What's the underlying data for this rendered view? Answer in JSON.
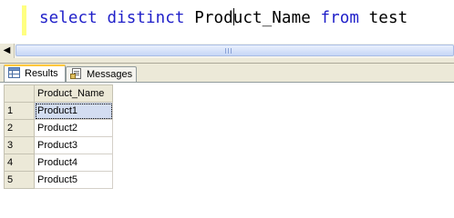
{
  "editor": {
    "keyword_select": "select",
    "keyword_distinct": "distinct",
    "identifier_before_caret": "Prod",
    "identifier_after_caret": "uct_Name",
    "keyword_from": "from",
    "table_name": "test"
  },
  "tabs": [
    {
      "label": "Results",
      "icon": "grid-icon",
      "active": true
    },
    {
      "label": "Messages",
      "icon": "messages-icon",
      "active": false
    }
  ],
  "grid": {
    "columns": [
      "Product_Name"
    ],
    "rows": [
      {
        "num": "1",
        "value": "Product1",
        "selected": true
      },
      {
        "num": "2",
        "value": "Product2",
        "selected": false
      },
      {
        "num": "3",
        "value": "Product3",
        "selected": false
      },
      {
        "num": "4",
        "value": "Product4",
        "selected": false
      },
      {
        "num": "5",
        "value": "Product5",
        "selected": false
      }
    ]
  },
  "colors": {
    "keyword": "#1f1fc9",
    "change_bar": "#ffff80",
    "selected_cell": "#d3ddf1",
    "active_tab_accent": "#ffc83c"
  }
}
